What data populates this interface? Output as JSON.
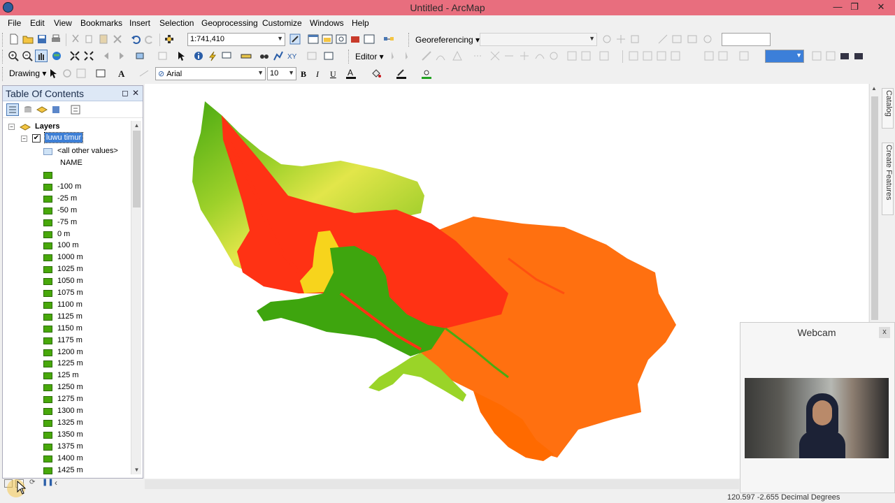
{
  "window": {
    "title": "Untitled - ArcMap",
    "minimize": "—",
    "maximize": "❐",
    "close": "✕"
  },
  "menu": [
    "File",
    "Edit",
    "View",
    "Bookmarks",
    "Insert",
    "Selection",
    "Geoprocessing",
    "Customize",
    "Windows",
    "Help"
  ],
  "toolbar": {
    "scale": "1:741,410",
    "georeferencing_label": "Georeferencing ▾",
    "editor_label": "Editor ▾",
    "drawing_label": "Drawing ▾",
    "font_name": "Arial",
    "font_size": "10",
    "bold": "B",
    "italic": "I",
    "underline": "U"
  },
  "toc": {
    "title": "Table Of Contents",
    "root": "Layers",
    "layer": "luwu timur",
    "all_other": "<all other values>",
    "field": "NAME",
    "legend": [
      "",
      "-100 m",
      "-25 m",
      "-50 m",
      "-75 m",
      "0 m",
      "100 m",
      "1000 m",
      "1025 m",
      "1050 m",
      "1075 m",
      "1100 m",
      "1125 m",
      "1150 m",
      "1175 m",
      "1200 m",
      "1225 m",
      "125 m",
      "1250 m",
      "1275 m",
      "1300 m",
      "1325 m",
      "1350 m",
      "1375 m",
      "1400 m",
      "1425 m"
    ]
  },
  "rail": {
    "catalog": "Catalog",
    "create_features": "Create Features"
  },
  "webcam": {
    "title": "Webcam",
    "close": "x"
  },
  "status": {
    "coords": "120.597  -2.655 Decimal Degrees"
  },
  "colors": {
    "titlebar": "#e86e7e",
    "low": "#3aa10b",
    "mid": "#f5d30f",
    "high": "#ff6a00",
    "peak": "#ff2a0a"
  }
}
